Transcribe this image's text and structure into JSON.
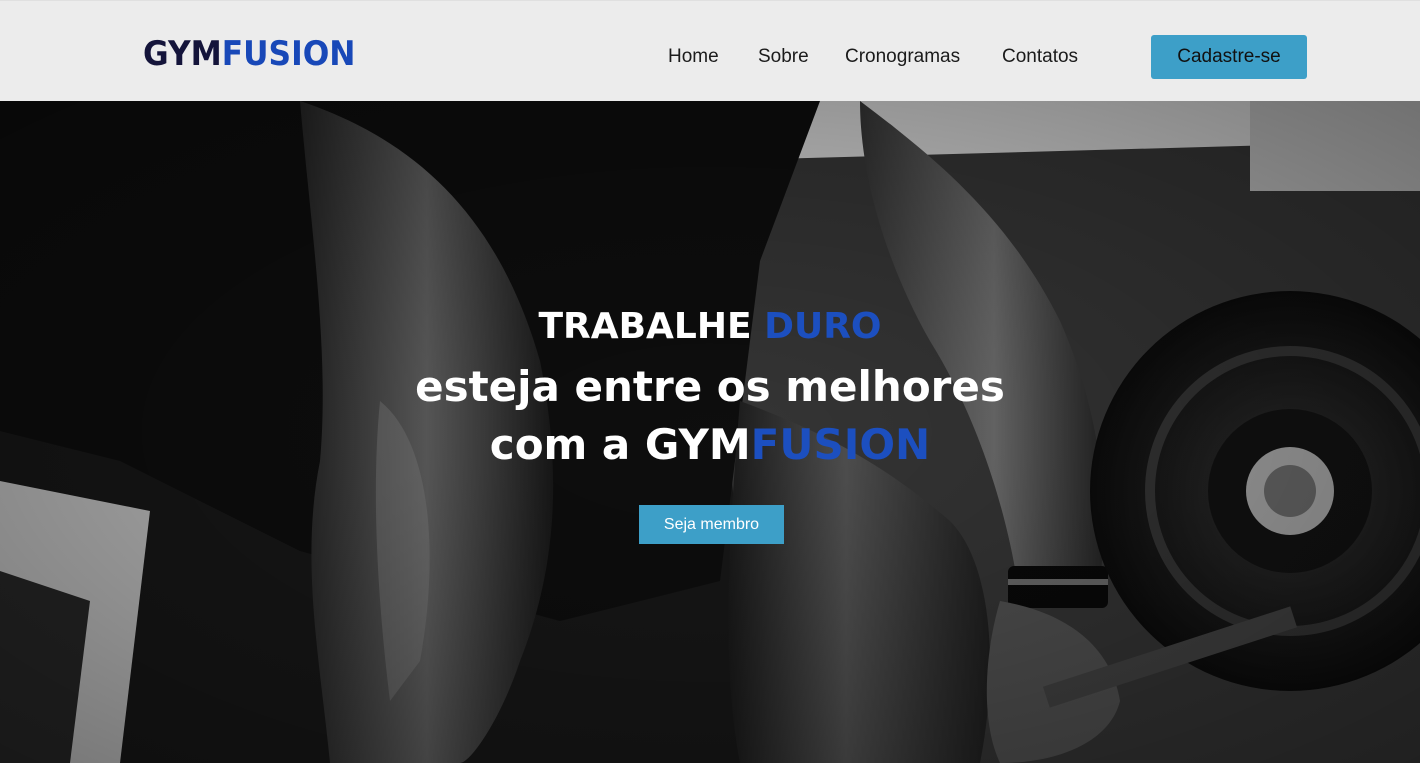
{
  "brand": {
    "part1": "GYM",
    "part2": "FUSION"
  },
  "nav": {
    "home": "Home",
    "about": "Sobre",
    "schedules": "Cronogramas",
    "contacts": "Contatos",
    "signup": "Cadastre-se"
  },
  "hero": {
    "line1_a": "TRABALHE ",
    "line1_b": "DURO",
    "line2": "esteja entre os melhores",
    "line3_a": "com a GYM",
    "line3_b": "FUSION",
    "cta": "Seja membro",
    "image": "black-and-white gym photo: athlete gripping a loaded barbell"
  },
  "colors": {
    "header_bg": "#ececec",
    "logo_dark": "#14143a",
    "brand_blue": "#1c4fbf",
    "button": "#3d9fc8"
  }
}
